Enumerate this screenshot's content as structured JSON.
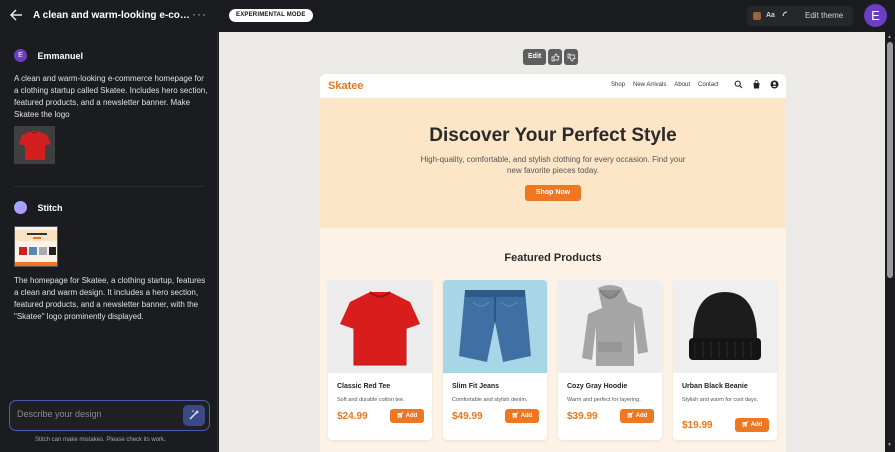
{
  "header": {
    "title": "A clean and warm-looking e-co…",
    "more_label": "···",
    "badge": "EXPERIMENTAL MODE",
    "theme_aa": "Aa",
    "edit_theme": "Edit theme",
    "avatar_letter": "E"
  },
  "chat": {
    "user": {
      "avatar_letter": "E",
      "name": "Emmanuel",
      "text": "A clean and warm-looking e-commerce homepage for a clothing startup called Skatee. Includes hero section, featured products, and a newsletter banner. Make Skatee the logo"
    },
    "assistant": {
      "name": "Stitch",
      "text": "The homepage for Skatee, a clothing startup, features a clean and warm design. It includes a hero section, featured products, and a newsletter banner, with the \"Skatee\" logo prominently displayed."
    },
    "input_placeholder": "Describe your design",
    "disclaimer": "Stitch can make mistakes. Please check its work."
  },
  "canvas": {
    "edit_label": "Edit"
  },
  "site": {
    "logo": "Skatee",
    "nav": [
      "Shop",
      "New Arrivals",
      "About",
      "Contact"
    ],
    "hero": {
      "title": "Discover Your Perfect Style",
      "subtitle": "High-quality, comfortable, and stylish clothing for every occasion. Find your new favorite pieces today.",
      "cta": "Shop Now"
    },
    "featured_title": "Featured Products",
    "add_label": "Add",
    "products": [
      {
        "name": "Classic Red Tee",
        "desc": "Soft and durable cotton tee.",
        "price": "$24.99"
      },
      {
        "name": "Slim Fit Jeans",
        "desc": "Comfortable and stylish denim.",
        "price": "$49.99"
      },
      {
        "name": "Cozy Gray Hoodie",
        "desc": "Warm and perfect for layering.",
        "price": "$39.99"
      },
      {
        "name": "Urban Black Beanie",
        "desc": "Stylish and warm for cool days.",
        "price": "$19.99"
      }
    ]
  },
  "colors": {
    "accent": "#f07722",
    "brand": "#e8781f",
    "hero_bg": "#fde5c8",
    "avatar": "#6a3fc2"
  }
}
